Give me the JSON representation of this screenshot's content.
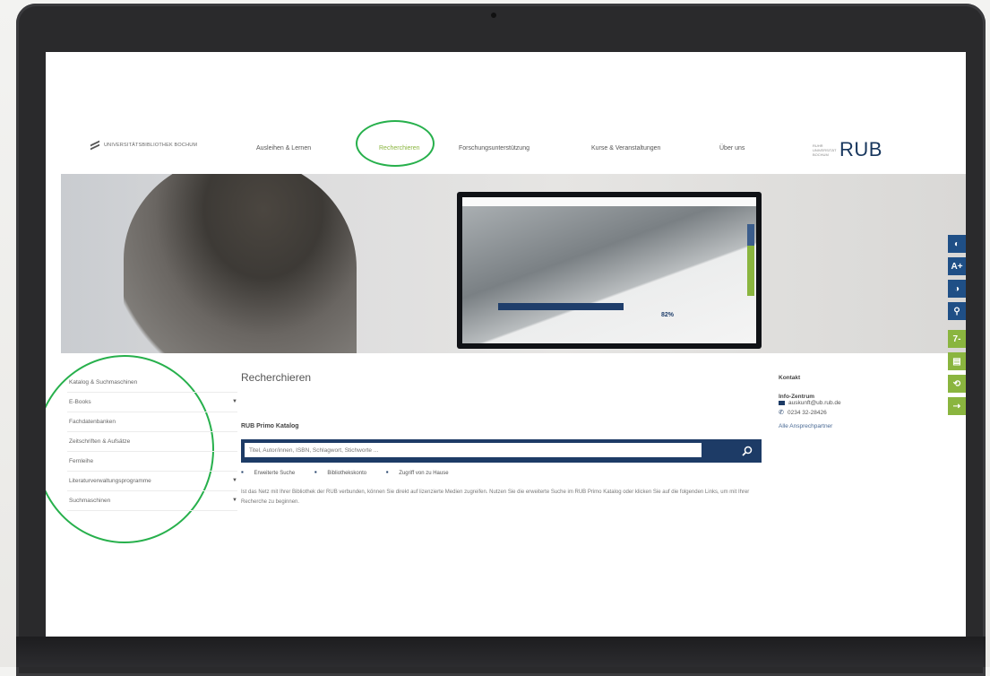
{
  "header": {
    "library_name": "UNIVERSITÄTSBIBLIOTHEK BOCHUM",
    "nav": [
      "Ausleihen & Lernen",
      "Recherchieren",
      "Forschungsunterstützung",
      "Kurse & Veranstaltungen",
      "Über uns"
    ],
    "active_nav_index": 1,
    "rub_logo_small": "RUHR UNIVERSITÄT BOCHUM",
    "rub_logo": "RUB"
  },
  "hero": {
    "monitor_percent": "82%"
  },
  "accessibility_rail": [
    {
      "icon": "contrast-icon",
      "glyph": "◐",
      "color": "#1f4f86"
    },
    {
      "icon": "text-size-icon",
      "glyph": "A+",
      "color": "#1f4f86"
    },
    {
      "icon": "dark-mode-icon",
      "glyph": "◑",
      "color": "#1f4f86"
    },
    {
      "icon": "search-icon",
      "glyph": "⚲",
      "color": "#1f4f86"
    },
    {
      "icon": "hours-icon",
      "glyph": "7-",
      "color": "#8ab53f"
    },
    {
      "icon": "calendar-icon",
      "glyph": "▤",
      "color": "#8ab53f"
    },
    {
      "icon": "login-icon",
      "glyph": "⟲",
      "color": "#8ab53f"
    },
    {
      "icon": "account-icon",
      "glyph": "⇢",
      "color": "#8ab53f"
    }
  ],
  "sidebar": {
    "items": [
      {
        "label": "Katalog & Suchmaschinen",
        "has_arrow": false
      },
      {
        "label": "E-Books",
        "has_arrow": true
      },
      {
        "label": "Fachdatenbanken",
        "has_arrow": false
      },
      {
        "label": "Zeitschriften & Aufsätze",
        "has_arrow": false
      },
      {
        "label": "Fernleihe",
        "has_arrow": false
      },
      {
        "label": "Literaturverwaltungsprogramme",
        "has_arrow": true
      },
      {
        "label": "Suchmaschinen",
        "has_arrow": true
      }
    ]
  },
  "main": {
    "title": "Recherchieren",
    "primo_label": "RUB Primo Katalog",
    "search_placeholder": "Titel, Autor/innen, ISBN, Schlagwort, Stichworte ...",
    "links": [
      "Erweiterte Suche",
      "Bibliothekskonto",
      "Zugriff von zu Hause"
    ],
    "body": "Ist das Netz mit Ihrer Bibliothek der RUB verbunden, können Sie direkt auf lizenzierte Medien zugreifen. Nutzen Sie die erweiterte Suche im RUB Primo Katalog oder klicken Sie auf die folgenden Links, um mit Ihrer Recherche zu beginnen."
  },
  "contact": {
    "title": "Kontakt",
    "name": "Info-Zentrum",
    "email": "auskunft@ub.rub.de",
    "phone": "0234 32-28426",
    "link": "Alle Ansprechpartner"
  },
  "colors": {
    "accent_green": "#8ab53f",
    "navy": "#1d3b66",
    "highlight_circle": "#27b04c"
  }
}
